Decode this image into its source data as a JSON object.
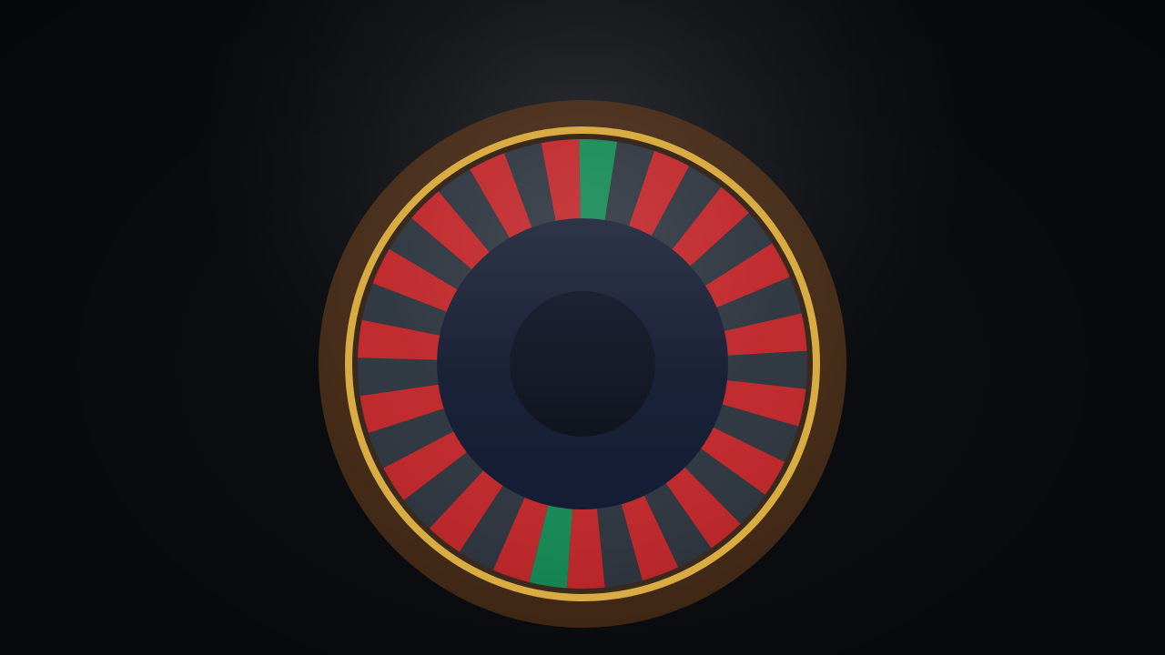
{
  "scene": {
    "background_color": "#0b0d11",
    "spotlight_color": "#2c2d31"
  },
  "wheel": {
    "type": "roulette",
    "pocket_count": 37,
    "pocket_pattern": [
      "green",
      "dark",
      "red",
      "dark",
      "red",
      "dark",
      "red",
      "dark",
      "red",
      "dark",
      "red",
      "dark",
      "red",
      "dark",
      "red",
      "dark",
      "red",
      "dark",
      "red",
      "green",
      "red",
      "dark",
      "red",
      "dark",
      "red",
      "dark",
      "red",
      "dark",
      "red",
      "dark",
      "red",
      "dark",
      "red",
      "dark",
      "red",
      "dark",
      "red"
    ],
    "colors": {
      "red": "#c0282b",
      "dark": "#2e3640",
      "green": "#178a56",
      "gold_ring": "#d8ac43",
      "outer_rim": "#4a3020",
      "hub": "#1b2438",
      "inner_hub": "#151b28"
    },
    "label_text": ""
  }
}
